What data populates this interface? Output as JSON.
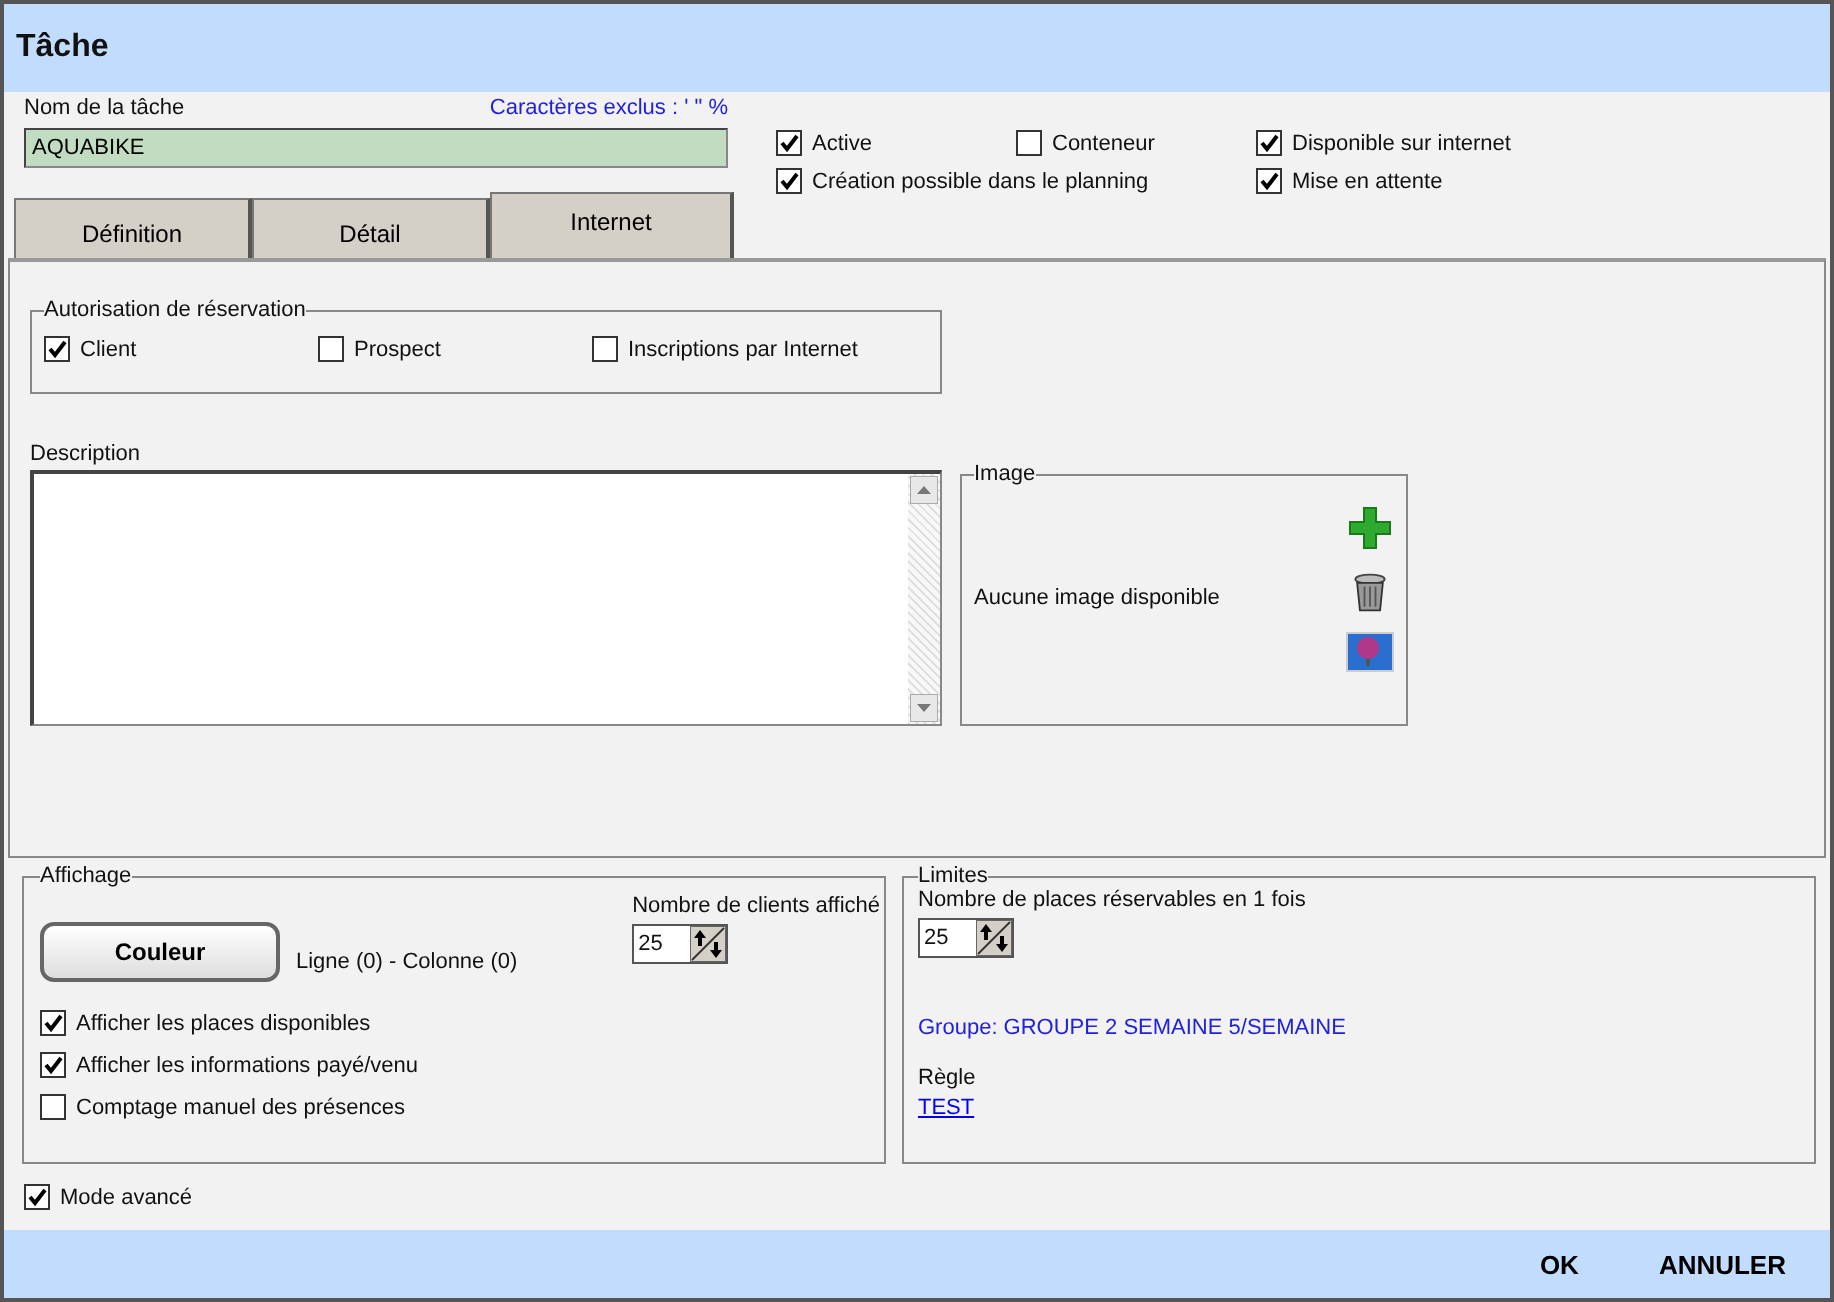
{
  "window": {
    "title": "Tâche"
  },
  "task_name": {
    "label": "Nom de la tâche",
    "hint": "Caractères exclus : ' \" %",
    "value": "AQUABIKE"
  },
  "options": [
    {
      "label": "Active",
      "checked": true
    },
    {
      "label": "Conteneur",
      "checked": false
    },
    {
      "label": "Disponible sur internet",
      "checked": true
    },
    {
      "label": "Création possible dans le planning",
      "checked": true
    },
    {
      "label": "Mise en attente",
      "checked": true
    }
  ],
  "tabs": [
    {
      "label": "Définition",
      "selected": false
    },
    {
      "label": "Détail",
      "selected": false
    },
    {
      "label": "Internet",
      "selected": true
    }
  ],
  "reservation": {
    "title": "Autorisation de réservation",
    "options": [
      {
        "label": "Client",
        "checked": true
      },
      {
        "label": "Prospect",
        "checked": false
      },
      {
        "label": "Inscriptions par Internet",
        "checked": false
      }
    ]
  },
  "description": {
    "label": "Description"
  },
  "image": {
    "title": "Image",
    "message": "Aucune image disponible"
  },
  "display": {
    "title": "Affichage",
    "button": "Couleur",
    "position": "Ligne (0) - Colonne (0)",
    "count_label": "Nombre de clients affiché",
    "count_value": "25",
    "options": [
      {
        "label": "Afficher les places disponibles",
        "checked": true
      },
      {
        "label": "Afficher les informations payé/venu",
        "checked": true
      },
      {
        "label": "Comptage manuel des présences",
        "checked": false
      }
    ]
  },
  "limits": {
    "title": "Limites",
    "places_label": "Nombre de places réservables en 1 fois",
    "places_value": "25",
    "group": "Groupe: GROUPE 2 SEMAINE 5/SEMAINE",
    "rule_label": "Règle",
    "rule_link": "TEST"
  },
  "advanced": {
    "label": "Mode avancé",
    "checked": true
  },
  "buttons": [
    "OK",
    "ANNULER"
  ]
}
